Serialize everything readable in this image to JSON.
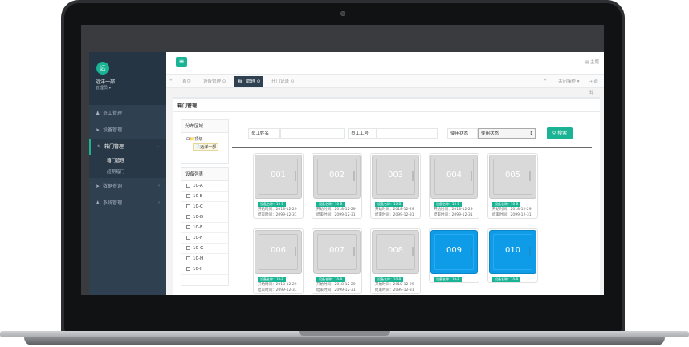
{
  "profile": {
    "avatar": "远",
    "name": "远洋一部",
    "role": "管理员 ▾"
  },
  "nav": [
    {
      "label": "员工管理",
      "icon": "user-icon"
    },
    {
      "label": "设备管理",
      "icon": "send-icon"
    },
    {
      "label": "箱门管理",
      "icon": "edit-icon",
      "active": true
    },
    {
      "label": "数据查询",
      "icon": "send-icon"
    },
    {
      "label": "系统管理",
      "icon": "user-icon"
    }
  ],
  "subnav": [
    "箱门管理",
    "超期箱门"
  ],
  "topbar": {
    "menu": "≡",
    "theme": "主题"
  },
  "tabs": [
    "首页",
    "设备管理 ⊙",
    "箱门管理 ⊙",
    "开门记录 ⊙"
  ],
  "tabs_right": {
    "close_ops": "关闭操作 ▾",
    "exit": "退出"
  },
  "panel_title": "箱门管理",
  "area_box": {
    "title": "分布区域",
    "root": "顶级",
    "child": "远洋一部"
  },
  "device_box": {
    "title": "设备列表",
    "items": [
      "10-A",
      "10-B",
      "10-C",
      "10-D",
      "10-E",
      "10-F",
      "10-G",
      "10-H",
      "10-I"
    ]
  },
  "filters": {
    "name_label": "员工姓名",
    "id_label": "员工工号",
    "status_label": "使用状态",
    "status_value": "使用状态",
    "search": "搜索"
  },
  "doors": [
    {
      "num": "001",
      "device": "设备名称：10-B",
      "start": "开始时间：2018-12-29",
      "end": "结束时间：2099-12-31",
      "color": "gray"
    },
    {
      "num": "002",
      "device": "设备名称：10-B",
      "start": "开始时间：2018-12-29",
      "end": "结束时间：2099-12-31",
      "color": "gray"
    },
    {
      "num": "003",
      "device": "设备名称：10-B",
      "start": "开始时间：2018-12-29",
      "end": "结束时间：2099-12-31",
      "color": "gray"
    },
    {
      "num": "004",
      "device": "设备名称：10-B",
      "start": "开始时间：2018-12-29",
      "end": "结束时间：2099-12-31",
      "color": "gray"
    },
    {
      "num": "005",
      "device": "设备名称：10-B",
      "start": "开始时间：2018-12-29",
      "end": "结束时间：2099-12-31",
      "color": "gray"
    },
    {
      "num": "006",
      "device": "设备名称：10-B",
      "start": "开始时间：2018-12-29",
      "end": "结束时间：2099-12-31",
      "color": "gray"
    },
    {
      "num": "007",
      "device": "设备名称：10-B",
      "start": "开始时间：2018-12-29",
      "end": "结束时间：2099-12-31",
      "color": "gray"
    },
    {
      "num": "008",
      "device": "设备名称：10-B",
      "start": "开始时间：2018-12-29",
      "end": "结束时间：2099-12-31",
      "color": "gray"
    },
    {
      "num": "009",
      "device": "设备名称：10-B",
      "start": "",
      "end": "",
      "color": "blue"
    },
    {
      "num": "010",
      "device": "设备名称：10-B",
      "start": "",
      "end": "",
      "color": "blue"
    }
  ]
}
